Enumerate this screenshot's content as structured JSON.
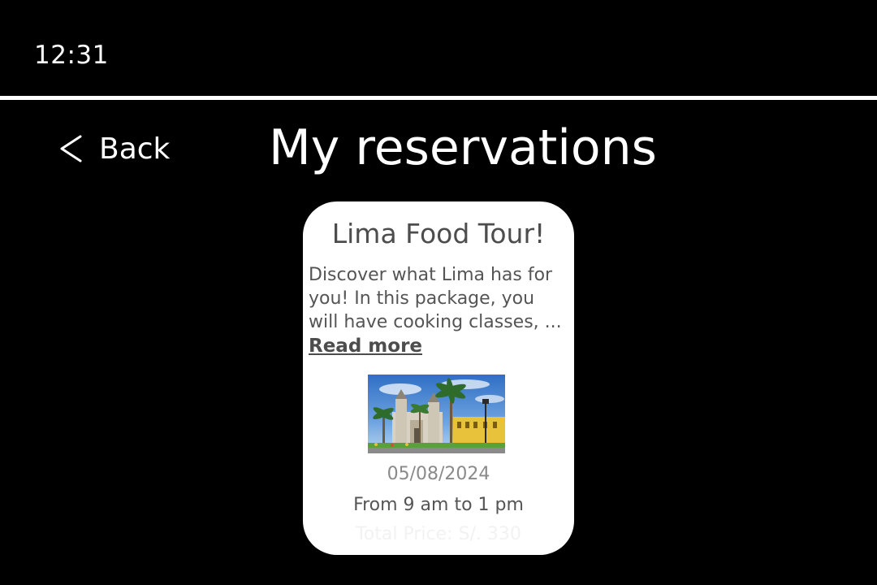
{
  "status_bar": {
    "time": "12:31"
  },
  "header": {
    "back_label": "Back",
    "title": "My reservations"
  },
  "reservation": {
    "title": "Lima Food Tour!",
    "description_lines": [
      "Discover what Lima has for",
      "you! In this package, you",
      "will have cooking classes, ..."
    ],
    "read_more_label": "Read more",
    "date": "05/08/2024",
    "hours": "From 9 am to 1 pm",
    "total_price": "Total Price: S/. 330"
  },
  "icons": {
    "back": "chevron-left-icon",
    "photo": "lima-cathedral-photo"
  },
  "colors": {
    "background": "#000000",
    "card": "#ffffff",
    "text_dark": "#4d4d4d",
    "text_muted": "#8a8a8a"
  }
}
